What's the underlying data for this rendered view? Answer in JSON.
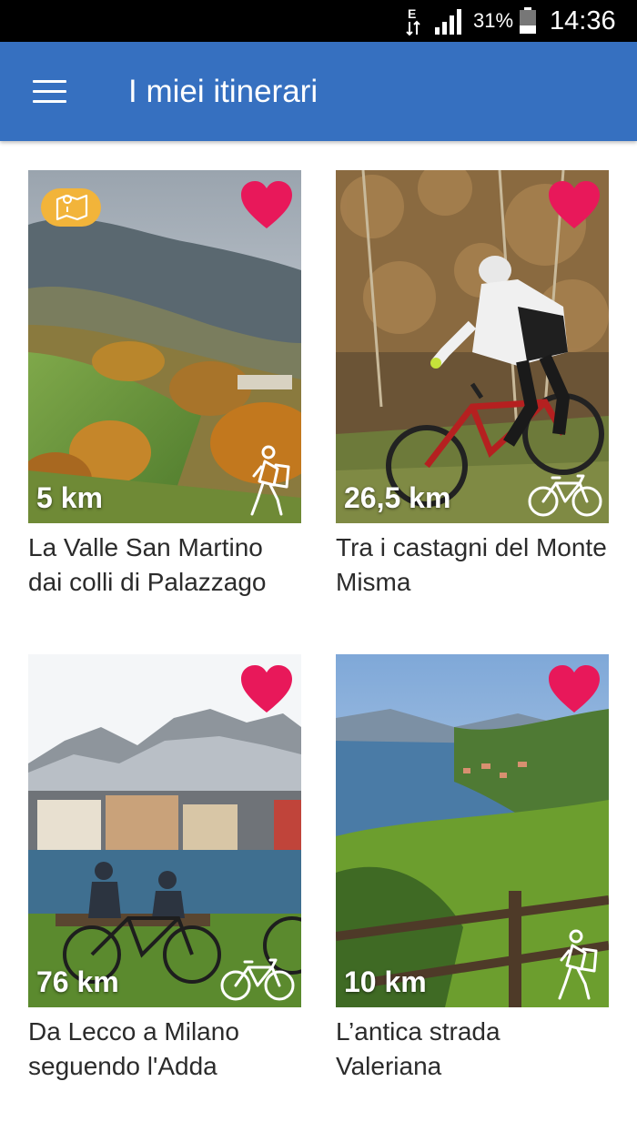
{
  "status_bar": {
    "network_type": "E",
    "battery_percent": "31%",
    "time": "14:36",
    "icons": [
      "data-arrows-icon",
      "signal-icon",
      "battery-icon"
    ]
  },
  "app_bar": {
    "title": "I miei itinerari",
    "menu_icon": "hamburger-menu-icon",
    "color": "#3670c0"
  },
  "colors": {
    "heart": "#e8185a",
    "map_badge": "#f2b43a"
  },
  "itineraries": [
    {
      "title": "La Valle San Martino dai colli di Palazzago",
      "distance": "5 km",
      "mode": "hiking-icon",
      "favorite": true,
      "has_map_badge": true
    },
    {
      "title": "Tra i castagni del Monte Misma",
      "distance": "26,5 km",
      "mode": "bicycle-icon",
      "favorite": true,
      "has_map_badge": false
    },
    {
      "title": "Da Lecco a Milano seguendo l'Adda",
      "distance": "76 km",
      "mode": "bicycle-icon",
      "favorite": true,
      "has_map_badge": false
    },
    {
      "title": "L’antica strada Valeriana",
      "distance": "10 km",
      "mode": "hiking-icon",
      "favorite": true,
      "has_map_badge": false
    }
  ]
}
